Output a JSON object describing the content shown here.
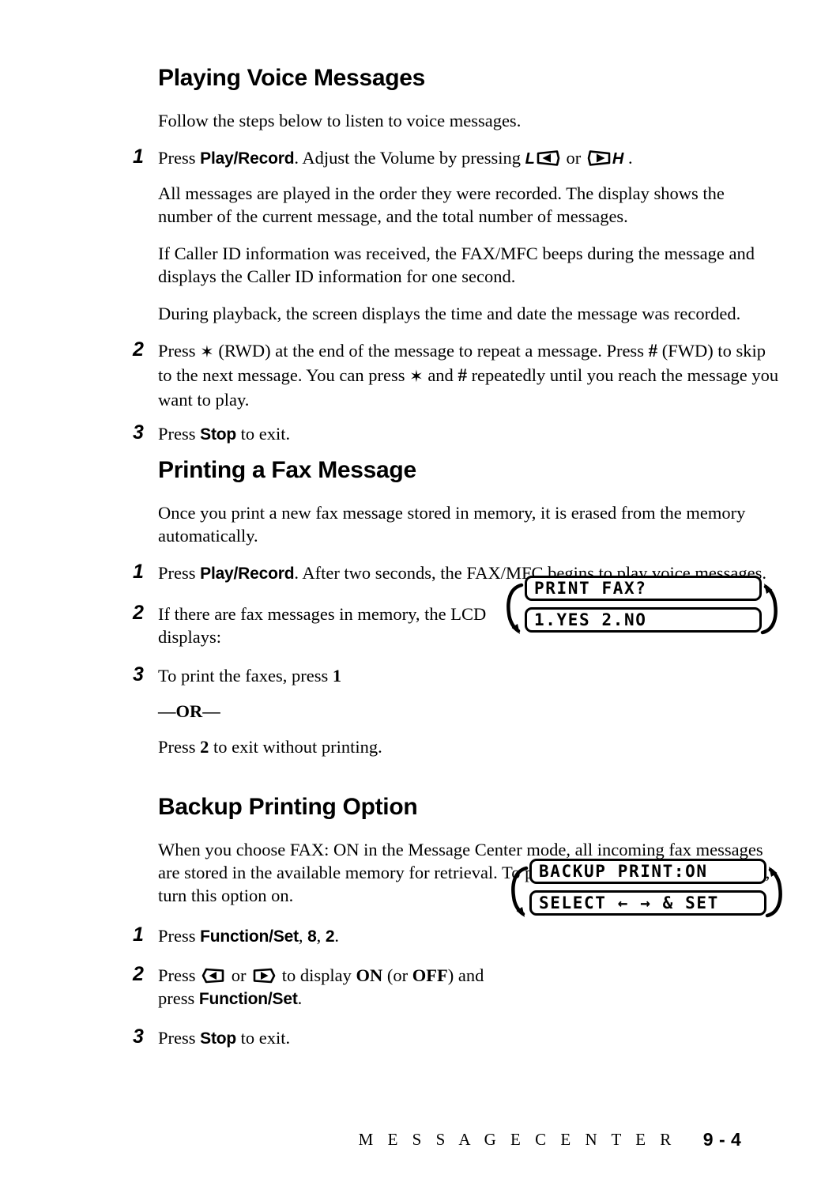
{
  "document": {
    "page_label": "9 - 4",
    "footer_title": "M E S S A G E   C E N T E R"
  },
  "sections": [
    {
      "id": "playing-voice-messages",
      "heading": "Playing Voice Messages",
      "intro": "Follow the steps below to listen to voice messages.",
      "steps": [
        {
          "number": "1",
          "text_a": "Press ",
          "bold_a": "Play/Record",
          "text_b": ". Adjust the Volume by pressing ",
          "icon_low_label": "L",
          "icon_low_name": "volume-down-icon",
          "or_word": " or ",
          "icon_high_label": "H",
          "icon_high_name": "volume-up-icon",
          "text_c": " ."
        },
        {
          "number": "2",
          "text_a": "Press ",
          "star": "✶",
          "text_b": " (RWD) at the end of the message to repeat a message. Press ",
          "hash": "#",
          "text_c": " (FWD) to skip to the next message. You can press ",
          "star2": "✶",
          "text_d": " and ",
          "hash2": "#",
          "text_e": " repeatedly until you reach the message you want to play."
        },
        {
          "number": "3",
          "text_a": "Press ",
          "bold_a": "Stop",
          "text_b": " to exit."
        }
      ],
      "paragraphs": [
        "All messages are played in the order they were recorded. The display shows the number of the current message, and the total number of messages.",
        "If Caller ID information was received, the FAX/MFC beeps during the message and displays the Caller ID information for one second.",
        "During playback, the screen displays the time and date the message was recorded."
      ]
    },
    {
      "id": "printing-a-fax-message",
      "heading": "Printing a Fax Message",
      "intro": "Once you print a new fax message stored in memory, it is erased from the memory automatically.",
      "steps": [
        {
          "number": "1",
          "text_a": "Press ",
          "bold_a": "Play/Record",
          "text_b": ". After two seconds, the FAX/MFC begins to play voice messages."
        },
        {
          "number": "2",
          "text_a": "If there are fax messages in memory, the LCD displays:"
        },
        {
          "number": "3",
          "text_a": "To print the faxes, press ",
          "bold_a": "1",
          "or_label": "—OR—",
          "sub_a": "Press ",
          "sub_bold": "2",
          "sub_b": " to exit without printing."
        }
      ]
    },
    {
      "id": "backup-printing-option",
      "heading": "Backup Printing Option",
      "intro": "When you choose FAX: ON in the Message Center mode, all incoming fax messages are stored in the available memory for retrieval. To print a backup copy automatically, turn this option on.",
      "steps": [
        {
          "number": "1",
          "text_a": "Press ",
          "bold_a": "Function/Set",
          "text_b": ", ",
          "bold_b": "8",
          "text_c": ", ",
          "bold_c": "2",
          "text_d": "."
        },
        {
          "number": "2",
          "text_a": "Press ",
          "icon_left_name": "arrow-left-key-icon",
          "or_word": " or ",
          "icon_right_name": "arrow-right-key-icon",
          "text_b": " to display ",
          "bold_on": "ON",
          "text_c": " (or ",
          "bold_off": "OFF",
          "text_d": ") and press ",
          "bold_fn": "Function/Set",
          "text_e": "."
        },
        {
          "number": "3",
          "text_a": "Press ",
          "bold_a": "Stop",
          "text_b": " to exit."
        }
      ]
    }
  ],
  "lcd_displays": [
    {
      "id": "print-fax-prompt",
      "line1": "PRINT FAX?",
      "line2": "1.YES 2.NO"
    },
    {
      "id": "backup-print-setting",
      "line1": "BACKUP PRINT:ON",
      "line2": "SELECT ← → & SET"
    }
  ],
  "colors": {
    "ink": "#000000",
    "paper": "#ffffff"
  }
}
